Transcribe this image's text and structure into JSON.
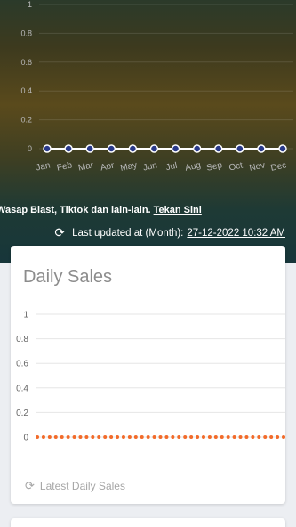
{
  "monthly": {
    "chart_data": {
      "type": "line",
      "categories": [
        "Jan",
        "Feb",
        "Mar",
        "Apr",
        "May",
        "Jun",
        "Jul",
        "Aug",
        "Sep",
        "Oct",
        "Nov",
        "Dec"
      ],
      "series": [
        {
          "values": [
            0,
            0,
            0,
            0,
            0,
            0,
            0,
            0,
            0,
            0,
            0,
            0
          ]
        }
      ],
      "yticks": [
        "0",
        "0.2",
        "0.4",
        "0.6",
        "0.8",
        "1"
      ],
      "ylim": [
        0,
        1
      ],
      "grid": true
    },
    "colors": {
      "line": "#ffffff",
      "point": "#2a3a8a",
      "tick": "#b8b8b8",
      "grid": "rgba(255,255,255,0.12)"
    }
  },
  "promo": {
    "text": "Wasap Blast, Tiktok dan lain-lain.",
    "link": "Tekan Sini"
  },
  "updated": {
    "icon": "refresh-icon",
    "label": "Last updated at (Month):",
    "stamp": "27-12-2022 10:32 AM"
  },
  "daily": {
    "title": "Daily Sales",
    "chart_data": {
      "type": "line",
      "series": [
        {
          "values": [
            0,
            0,
            0,
            0,
            0,
            0,
            0,
            0,
            0,
            0,
            0,
            0,
            0,
            0,
            0,
            0,
            0,
            0,
            0,
            0,
            0,
            0,
            0,
            0,
            0,
            0,
            0,
            0,
            0,
            0,
            0,
            0,
            0,
            0,
            0,
            0,
            0,
            0,
            0,
            0,
            0
          ]
        }
      ],
      "yticks": [
        "0",
        "0.2",
        "0.4",
        "0.6",
        "0.8",
        "1"
      ],
      "ylim": [
        0,
        1
      ],
      "grid": true
    },
    "colors": {
      "point": "#f26b2a",
      "tick": "#666666",
      "grid": "#e6e6e6"
    },
    "footer": "Latest Daily Sales",
    "footer_icon": "refresh-icon"
  }
}
